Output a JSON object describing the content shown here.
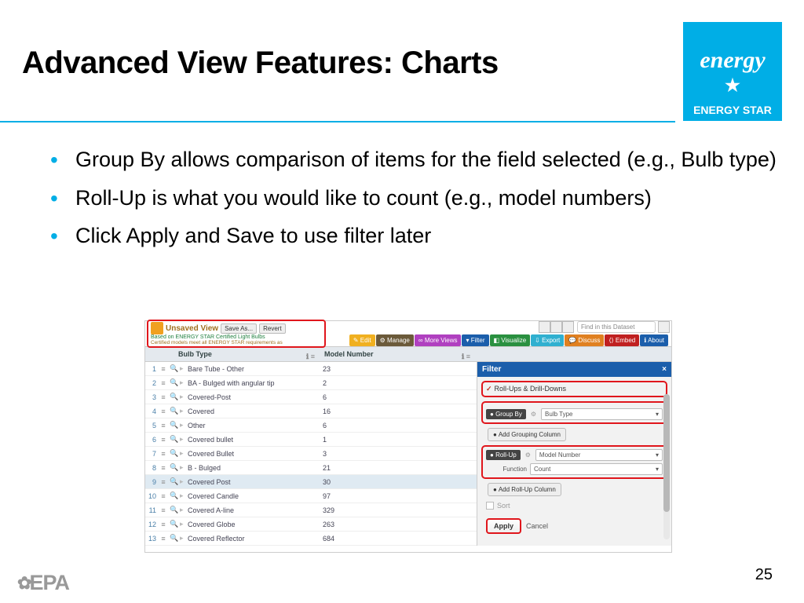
{
  "title": "Advanced View Features: Charts",
  "logo": {
    "script": "energy",
    "star": "★",
    "label": "ENERGY STAR"
  },
  "bullets": [
    "Group By allows comparison of items for the field selected (e.g., Bulb type)",
    "Roll-Up is what you would like to count (e.g., model numbers)",
    "Click Apply and Save to use filter later"
  ],
  "unsaved": {
    "title": "Unsaved View",
    "saveas": "Save As...",
    "revert": "Revert",
    "based": "Based on ENERGY STAR Certified Light Bulbs",
    "note": "Certified models meet all ENERGY STAR requirements as"
  },
  "toolbar": {
    "edit": "Edit",
    "manage": "Manage",
    "more": "More Views",
    "filter": "Filter",
    "viz": "Visualize",
    "export": "Export",
    "discuss": "Discuss",
    "embed": "Embed",
    "about": "About",
    "search": "Find in this Dataset"
  },
  "columns": {
    "c1": "Bulb Type",
    "c2": "Model Number"
  },
  "rows": [
    {
      "n": "1",
      "bt": "Bare Tube - Other",
      "mn": "23"
    },
    {
      "n": "2",
      "bt": "BA - Bulged with angular tip",
      "mn": "2"
    },
    {
      "n": "3",
      "bt": "Covered-Post",
      "mn": "6"
    },
    {
      "n": "4",
      "bt": "Covered",
      "mn": "16"
    },
    {
      "n": "5",
      "bt": "Other",
      "mn": "6"
    },
    {
      "n": "6",
      "bt": "Covered bullet",
      "mn": "1"
    },
    {
      "n": "7",
      "bt": "Covered Bullet",
      "mn": "3"
    },
    {
      "n": "8",
      "bt": "B - Bulged",
      "mn": "21"
    },
    {
      "n": "9",
      "bt": "Covered Post",
      "mn": "30",
      "sel": true
    },
    {
      "n": "10",
      "bt": "Covered Candle",
      "mn": "97"
    },
    {
      "n": "11",
      "bt": "Covered A-line",
      "mn": "329"
    },
    {
      "n": "12",
      "bt": "Covered Globe",
      "mn": "263"
    },
    {
      "n": "13",
      "bt": "Covered Reflector",
      "mn": "684"
    }
  ],
  "panel": {
    "title": "Filter",
    "close": "×",
    "rudd": "Roll-Ups & Drill-Downs",
    "groupby": "Group By",
    "groupby_val": "Bulb Type",
    "addgroup": "Add Grouping Column",
    "rollup": "Roll-Up",
    "rollup_val": "Model Number",
    "function": "Function",
    "function_val": "Count",
    "addroll": "Add Roll-Up Column",
    "sort": "Sort",
    "apply": "Apply",
    "cancel": "Cancel"
  },
  "epa": "EPA",
  "pagenum": "25"
}
